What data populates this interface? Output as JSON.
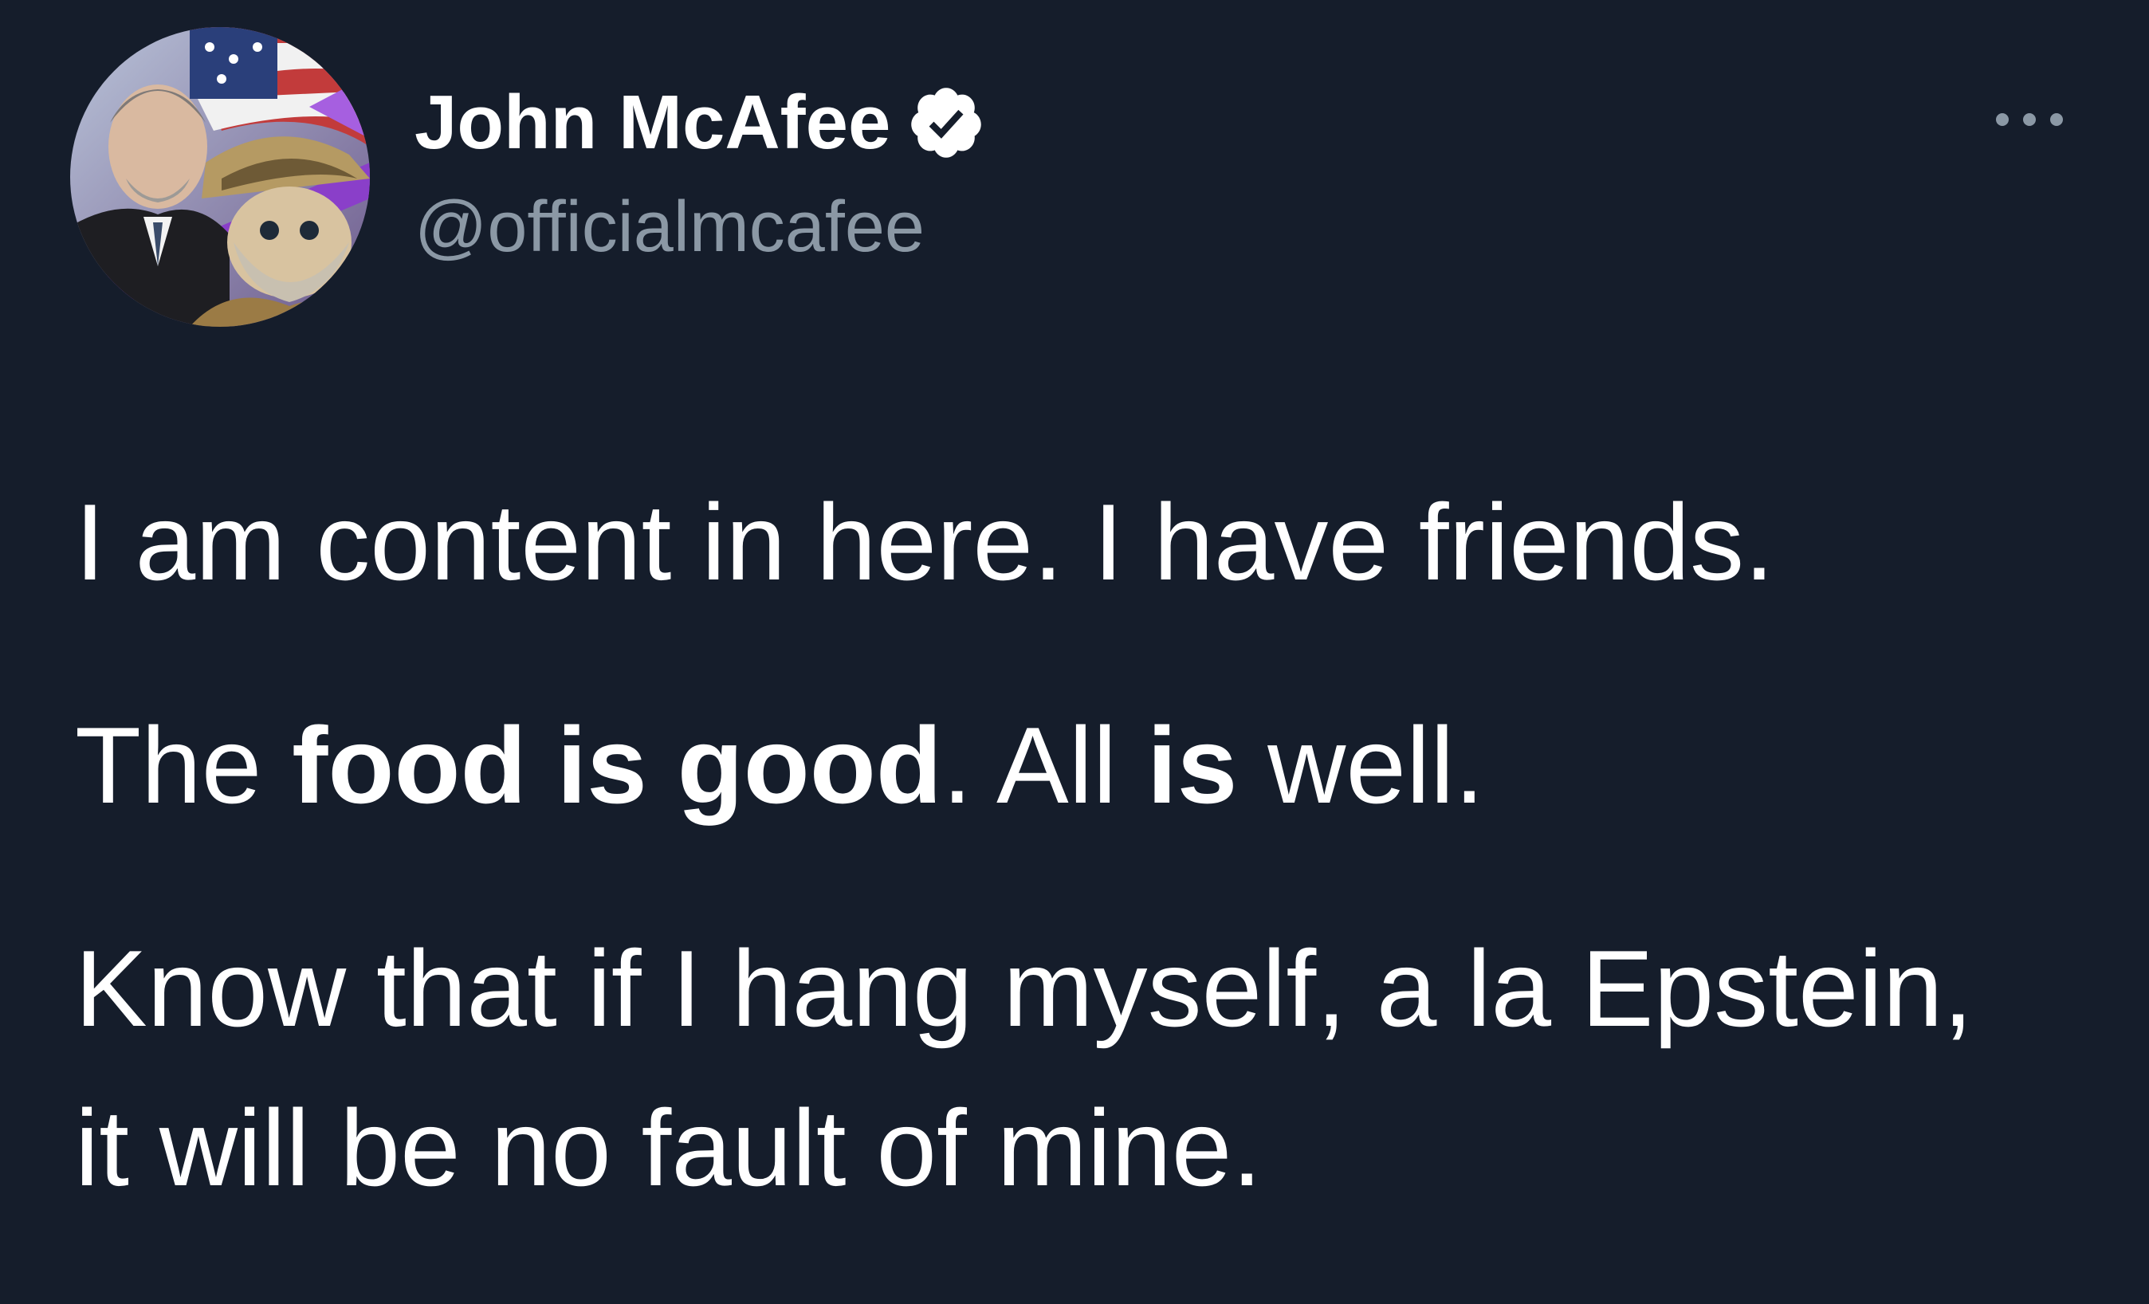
{
  "author": {
    "display_name": "John McAfee",
    "handle": "@officialmcafee",
    "verified": true
  },
  "icons": {
    "avatar": "profile-photo",
    "verified": "verified-badge-icon",
    "more": "more-options-icon"
  },
  "colors": {
    "background": "#151d2b",
    "text": "#ffffff",
    "handle": "#8b98a5",
    "badge": "#ffffff"
  },
  "tweet": {
    "paragraph1": "I am content in here. I have friends.",
    "paragraph2": {
      "part1": "The ",
      "bold1": "food is good",
      "part2": ". All ",
      "bold2": "is",
      "part3": " well."
    },
    "paragraph3": {
      "line1": "Know that if I hang myself, a la Epstein,",
      "line2": "it will be no fault of mine."
    }
  }
}
